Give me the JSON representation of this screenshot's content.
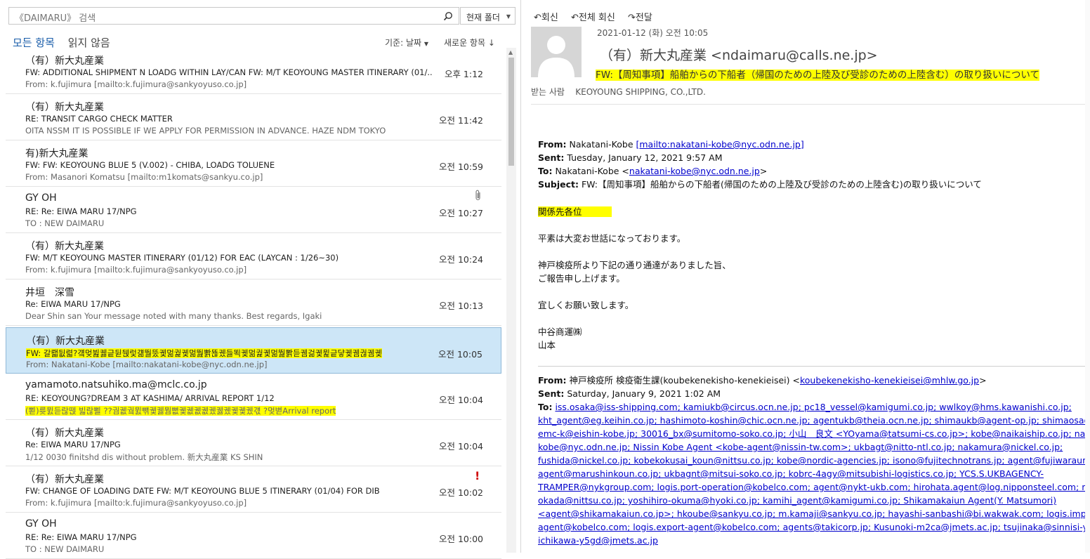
{
  "search": {
    "placeholder": "《DAIMARU》 검색",
    "scope": "현재 폴더"
  },
  "tabs": {
    "all": "모든 항목",
    "unread": "읽지 않음"
  },
  "sort": {
    "by": "기준: 날짜",
    "order": "새로운 항목 ↓"
  },
  "messages": [
    {
      "sender": "（有）新大丸産業",
      "subject": "FW: ADDITIONAL SHIPMENT N LOADG WITHIN LAY/CAN FW: M/T KEOYOUNG MASTER ITINERARY (01/...",
      "preview": "From: k.fujimura [mailto:k.fujimura@sankyoyuso.co.jp]",
      "time": "오후 1:12"
    },
    {
      "sender": "（有）新大丸産業",
      "subject": "RE: TRANSIT CARGO CHECK MATTER",
      "preview": "OITA NSSM  IT IS POSSIBLE IF WE APPLY FOR PERMISSION IN ADVANCE.  HAZE  NDM TOKYO",
      "time": "오전 11:42"
    },
    {
      "sender": "有)新大丸産業",
      "subject": "FW: FW: KEOYOUNG BLUE 5 (V.002) - CHIBA, LOADG TOLUENE",
      "preview": "From: Masanori Komatsu [mailto:m1komats@sankyu.co.jp]",
      "time": "오전 10:59"
    },
    {
      "sender": "GY OH",
      "subject": "RE: Re: EIWA MARU 17/NPG",
      "preview": "TO : NEW DAIMARU",
      "time": "오전 10:27"
    },
    {
      "sender": "（有）新大丸産業",
      "subject": "FW: M/T KEOYOUNG MASTER ITINERARY (01/12) FOR EAC (LAYCAN : 1/26~30)",
      "preview": "From: k.fujimura [mailto:k.fujimura@sankyoyuso.co.jp]",
      "time": "오전 10:24"
    },
    {
      "sender": "井垣　深雪",
      "subject": "Re: EIWA MARU 17/NPG",
      "preview": "Dear  Shin san  Your message noted with many thanks.  Best regards,  Igaki",
      "time": "오전 10:13"
    },
    {
      "sender": "（有）新大丸産業",
      "subject": "FW: 갈뢟뒶렯?걬멎뷢궳긑뒫뒍렃걞뛀뚰궻멂궕궻멂뛆뽥뚆궸듫뙥궻멂궕궻멂뛆뽥듣궴걺궻뮕긑댷궻궴궎궴궻",
      "preview": "From: Nakatani-Kobe [mailto:nakatani-kobe@nyc.odn.ne.jp]",
      "time": "오전 10:05"
    },
    {
      "sender": "yamamoto.natsuhiko.ma@mclc.co.jp",
      "subject": "RE: KEOYOUNG?DREAM 3  AT KASHIMA/ ARRIVAL REPORT  1/12",
      "preview": "(뾛)륫뮔듣랂뗁    빏랂뾜   ??궘궶궠뮔뺶궻궳뭠뼚궻궶궶궶궸궳궸궻궻궸걗  ?멎볃Arrival report",
      "time": "오전 10:04"
    },
    {
      "sender": "（有）新大丸産業",
      "subject": "Re: EIWA MARU 17/NPG",
      "preview": "1/12 0030 finitshd dis without  problem.  新大丸産業 KS SHIN",
      "time": "오전 10:04"
    },
    {
      "sender": "（有）新大丸産業",
      "subject": "FW: CHANGE OF LOADING DATE FW: M/T KEOYOUNG BLUE 5 ITINERARY (01/04) FOR DIB",
      "preview": "From: k.fujimura [mailto:k.fujimura@sankyoyuso.co.jp]",
      "time": "오전 10:02"
    },
    {
      "sender": "GY OH",
      "subject": "RE: Re: EIWA MARU 17/NPG",
      "preview": "TO : NEW DAIMARU",
      "time": "오전 10:00"
    }
  ],
  "reading": {
    "actions": {
      "reply": "회신",
      "reply_all": "전체 회신",
      "forward": "전달"
    },
    "date": "2021-01-12 (화) 오전 10:05",
    "from": "（有）新大丸産業 <ndaimaru@calls.ne.jp>",
    "subject": "FW:【周知事項】船舶からの下船者（帰国のための上陸及び受診のための上陸含む）の取り扱いについて",
    "to_label": "받는 사람",
    "to": "KEOYOUNG SHIPPING, CO.,LTD.",
    "body": {
      "from_label": "From:",
      "from_name": "Nakatani-Kobe",
      "from_link": "[mailto:nakatani-kobe@nyc.odn.ne.jp]",
      "sent_label": "Sent:",
      "sent": "Tuesday, January 12, 2021 9:57 AM",
      "to_label": "To:",
      "to_name": "Nakatani-Kobe <",
      "to_link": "nakatani-kobe@nyc.odn.ne.jp",
      "to_end": ">",
      "subject_label": "Subject:",
      "subject": "FW:【周知事項】船舶からの下船者(帰国のための上陸及び受診のための上陸含む)の取り扱いについて",
      "greeting": "関係先各位",
      "p1": "平素は大変お世話になっております。",
      "p2a": "神戸検疫所より下記の通り通達がありました旨、",
      "p2b": "ご報告申し上げます。",
      "p3": "宜しくお願い致します。",
      "sig1": "中谷商運㈱",
      "sig2": "山本",
      "from2_label": "From:",
      "from2": "神戸検疫所 検疫衛生課(koubekenekisho-kenekieisei) <",
      "from2_link": "koubekenekisho-kenekieisei@mhlw.go.jp",
      "from2_end": ">",
      "sent2_label": "Sent:",
      "sent2": "Saturday, January 9, 2021 1:02 AM",
      "to2_label": "To:",
      "recipients_lines": [
        "iss.osaka@iss-shipping.com; kamiukb@circus.ocn.ne.jp; pc18_vessel@kamigumi.co.jp; wwlkoy@hms.kawanishi.co.jp;",
        "kht_agent@eg.keihin.co.jp; hashimoto-koshin@chic.ocn.ne.jp; agentukb@theia.ocn.ne.jp; shimaukb@agent-op.jp; shimaosa@agen",
        "emc-k@eishin-kobe.jp; 30016_bx@sumitomo-soko.co.jp; 小山　良文 <YOyama@tatsumi-cs.co.jp>; kobe@naikaiship.co.jp; nakatan",
        "kobe@nyc.odn.ne.jp; Nissin Kobe Agent <kobe-agent@nissin-tw.com>; ukbagt@nitto-ntl.co.jp; nakamura@nickel.co.jp;",
        "fushida@nickel.co.jp; kobekokusai_koun@nittsu.co.jp; kobe@nordic-agencies.jp; isono@fujitechnotrans.jp; agent@fujiwaraunyu.co",
        "agent@marushinkoun.co.jp; ukbagnt@mitsui-soko.co.jp; kobrc-4agy@mitsubishi-logistics.co.jp; YCS.S.UKBAGENCY-",
        "TRAMPER@nykgroup.com; logis.port-operation@kobelco.com; agent@nykt-ukb.com; hirohata.agent@log.nipponsteel.com; mae-",
        "okada@nittsu.co.jp; yoshihiro-okuma@hyoki.co.jp; kamihi_agent@kamigumi.co.jp; Shikamakaiun Agent(Y. Matsumori)",
        "<agent@shikamakaiun.co.jp>; hkoube@sankyu.co.jp; m.kamaji@sankyu.co.jp; hayashi-sanbashi@bi.wakwak.com; logis.import-",
        "agent@kobelco.com; logis.export-agent@kobelco.com; agents@takicorp.jp; Kusunoki-m2ca@jmets.ac.jp; tsujinaka@sinnisi-yh.co.j",
        "ichikawa-y5gd@jmets.ac.jp"
      ]
    }
  }
}
